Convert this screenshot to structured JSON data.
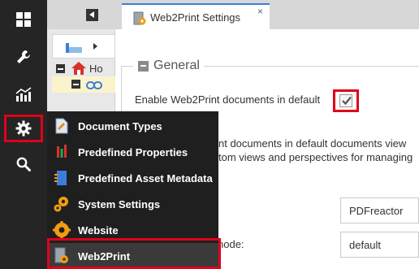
{
  "rail": {
    "items": [
      "dashboard-icon",
      "wrench-icon",
      "chart-icon",
      "gear-icon",
      "search-icon"
    ]
  },
  "tree": {
    "home_label": "Ho"
  },
  "tab": {
    "label": "Web2Print Settings",
    "close": "×"
  },
  "section": {
    "legend": "General",
    "enable_label": "Enable Web2Print documents in default",
    "enable_checked": true,
    "desc_line1": "nt documents in default documents view",
    "desc_line2": "tom views and perspectives for managing",
    "field1_value": "PDFreactor",
    "field2_label": "node:",
    "field2_value": "default"
  },
  "menu": {
    "items": [
      {
        "label": "Document Types",
        "icon": "document-types-icon"
      },
      {
        "label": "Predefined Properties",
        "icon": "predefined-properties-icon"
      },
      {
        "label": "Predefined Asset Metadata",
        "icon": "asset-metadata-icon"
      },
      {
        "label": "System Settings",
        "icon": "system-settings-icon"
      },
      {
        "label": "Website",
        "icon": "website-icon"
      },
      {
        "label": "Web2Print",
        "icon": "web2print-icon"
      }
    ]
  },
  "colors": {
    "rail_bg": "#252525",
    "menu_bg": "#1f1f1f",
    "highlight_red": "#e1001a",
    "accent_orange": "#f39c12",
    "tab_accent": "#3c7dd9"
  }
}
